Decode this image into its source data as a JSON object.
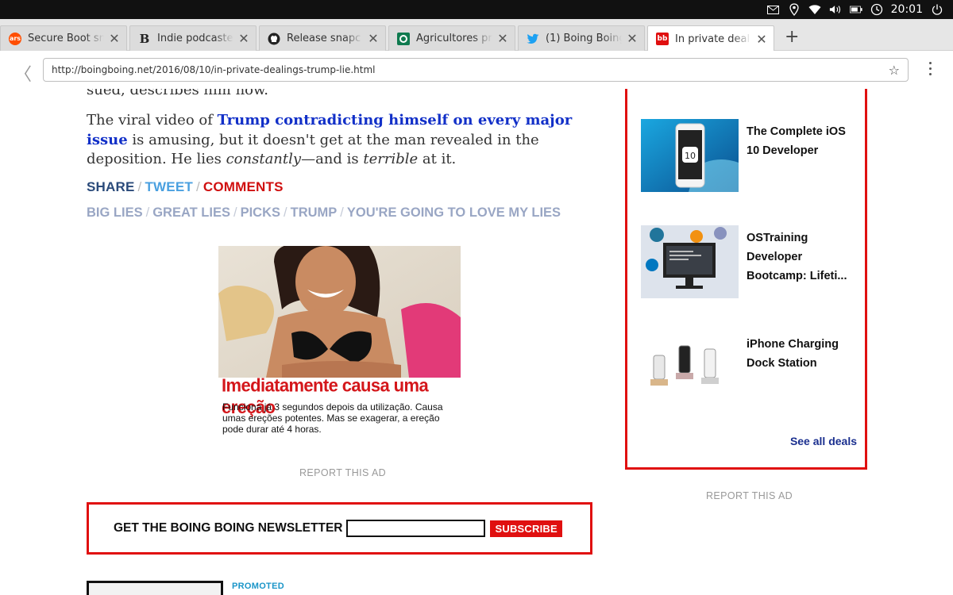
{
  "status_bar": {
    "clock": "20:01",
    "icons": [
      "mail-icon",
      "location-icon",
      "wifi-icon",
      "volume-icon",
      "battery-icon",
      "alarm-icon",
      "power-icon"
    ]
  },
  "tabs": [
    {
      "title": "Secure Boot sn",
      "favicon": "ars",
      "favicon_color": "#ff4e00",
      "active": false
    },
    {
      "title": "Indie podcaste",
      "favicon": "B",
      "favicon_color": "#ffffff",
      "active": false
    },
    {
      "title": "Release snapc",
      "favicon": "github",
      "favicon_color": "#222222",
      "active": false
    },
    {
      "title": "Agricultores pr",
      "favicon": "O",
      "favicon_color": "#0f7a4f",
      "active": false
    },
    {
      "title": "(1) Boing Boing",
      "favicon": "twitter",
      "favicon_color": "#1da1f2",
      "active": false
    },
    {
      "title": "In private deal",
      "favicon": "bb",
      "favicon_color": "#e01010",
      "active": true
    }
  ],
  "address_bar": {
    "url": "http://boingboing.net/2016/08/10/in-private-dealings-trump-lie.html"
  },
  "article": {
    "cut_line": "sued, describes him now.",
    "para_1": "The viral video of ",
    "link_text": "Trump contradicting himself on every major issue",
    "para_2": " is amusing, but it doesn't get at the man revealed in the deposition. He lies ",
    "em_1": "constantly",
    "para_3": "—and is ",
    "em_2": "terrible",
    "para_4": " at it.",
    "share": "SHARE",
    "tweet": "TWEET",
    "comments": "COMMENTS",
    "separator": "/",
    "tags": [
      "BIG LIES",
      "GREAT LIES",
      "PICKS",
      "TRUMP",
      "YOU'RE GOING TO LOVE MY LIES"
    ]
  },
  "ad": {
    "headline": "Imediatamente causa uma ereção",
    "body": "Funciona já 3 segundos depois da utilização. Causa umas ereções potentes. Mas se exagerar, a ereção pode durar até 4 horas.",
    "report": "REPORT THIS AD"
  },
  "newsletter": {
    "label": "GET THE BOING BOING NEWSLETTER",
    "input_value": "",
    "button": "SUBSCRIBE"
  },
  "promoted": "PROMOTED",
  "deals": {
    "items": [
      {
        "name": "The Complete iOS 10 Developer",
        "thumb": "ios-10-phone-icon"
      },
      {
        "name": "OSTraining Developer Bootcamp: Lifeti...",
        "thumb": "developer-monitor-icon"
      },
      {
        "name": "iPhone Charging Dock Station",
        "thumb": "charging-dock-icon"
      }
    ],
    "see_all": "See all deals",
    "report": "REPORT THIS AD"
  },
  "colors": {
    "accent_red": "#e01010",
    "link_blue": "#1230c8",
    "tag_grey_blue": "#99a6c4",
    "tweet_blue": "#4aa0e0"
  }
}
